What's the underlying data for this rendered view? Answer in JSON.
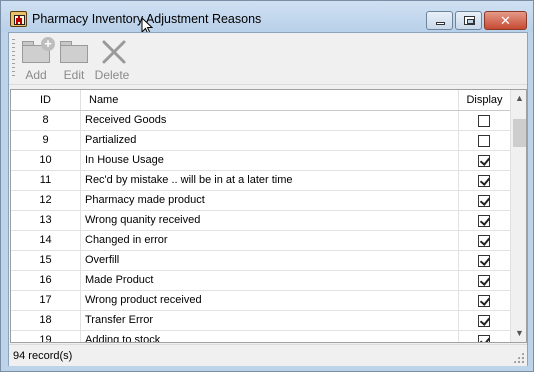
{
  "window": {
    "title": "Pharmacy Inventory Adjustment Reasons",
    "close_glyph": "✕"
  },
  "toolbar": {
    "add_label": "Add",
    "edit_label": "Edit",
    "delete_label": "Delete"
  },
  "grid": {
    "columns": [
      "ID",
      "Name",
      "Display"
    ],
    "rows": [
      {
        "id": "8",
        "name": "Received Goods",
        "display": false
      },
      {
        "id": "9",
        "name": "Partialized",
        "display": false
      },
      {
        "id": "10",
        "name": "In House Usage",
        "display": true
      },
      {
        "id": "11",
        "name": "Rec'd by mistake .. will be in at a later time",
        "display": true
      },
      {
        "id": "12",
        "name": "Pharmacy made product",
        "display": true
      },
      {
        "id": "13",
        "name": "Wrong quanity received",
        "display": true
      },
      {
        "id": "14",
        "name": "Changed in error",
        "display": true
      },
      {
        "id": "15",
        "name": "Overfill",
        "display": true
      },
      {
        "id": "16",
        "name": "Made Product",
        "display": true
      },
      {
        "id": "17",
        "name": "Wrong product received",
        "display": true
      },
      {
        "id": "18",
        "name": "Transfer Error",
        "display": true
      },
      {
        "id": "19",
        "name": "Adding to stock",
        "display": true
      }
    ],
    "scroll_up_glyph": "▲",
    "scroll_down_glyph": "▼"
  },
  "status": {
    "record_count": "94 record(s)"
  },
  "icons": {
    "add": "folder-add-icon",
    "edit": "folder-edit-icon",
    "delete": "delete-x-icon"
  }
}
